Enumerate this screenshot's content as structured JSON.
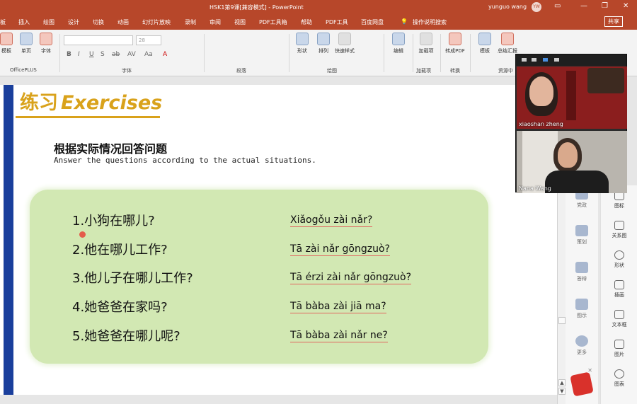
{
  "window": {
    "title": "HSK1第9课[兼容模式] - PowerPoint",
    "user_name": "yunguo wang",
    "user_initials": "YW",
    "share_label": "共享"
  },
  "tabs": [
    "板",
    "插入",
    "绘图",
    "设计",
    "切换",
    "动画",
    "幻灯片放映",
    "录制",
    "审阅",
    "视图",
    "PDF工具箱",
    "帮助",
    "PDF工具",
    "百度网盘",
    "操作说明搜索"
  ],
  "ribbon": {
    "buttons": [
      "模板",
      "单页",
      "字体",
      "形状",
      "排列",
      "快速样式",
      "编辑",
      "加载项",
      "转成PDF",
      "模板",
      "总结汇报",
      "素材图",
      "PDF转换",
      "绘本图"
    ],
    "groups": [
      "OfficePLUS",
      "字体",
      "段落",
      "绘图",
      "加载项",
      "转换",
      "资源中"
    ],
    "font_size": "28",
    "format_buttons": [
      "B",
      "I",
      "U",
      "S",
      "ab",
      "AV",
      "Aa",
      "A"
    ]
  },
  "slide": {
    "heading_cn": "练习",
    "heading_en": "Exercises",
    "instruction_cn": "根据实际情况回答问题",
    "instruction_en": "Answer the questions according to the actual situations.",
    "questions": [
      {
        "cn": "1.小狗在哪儿?",
        "pinyin": "Xiǎogǒu zài nǎr?"
      },
      {
        "cn": "2.他在哪儿工作?",
        "pinyin": "Tā zài nǎr gōngzuò?"
      },
      {
        "cn": "3.他儿子在哪儿工作?",
        "pinyin": "Tā érzi zài nǎr gōngzuò?"
      },
      {
        "cn": "4.她爸爸在家吗?",
        "pinyin": "Tā bàba zài jiā ma?"
      },
      {
        "cn": "5.她爸爸在哪儿呢?",
        "pinyin": "Tā bàba zài nǎr ne?"
      }
    ]
  },
  "side_pane1": [
    "党政",
    "策划",
    "答辩",
    "图示",
    "更多"
  ],
  "side_pane2": [
    "图标",
    "关系图",
    "形状",
    "插画",
    "文本框",
    "图片",
    "图表"
  ],
  "video": {
    "participants": [
      "xiaoshan zheng",
      "Nana Wang"
    ]
  }
}
